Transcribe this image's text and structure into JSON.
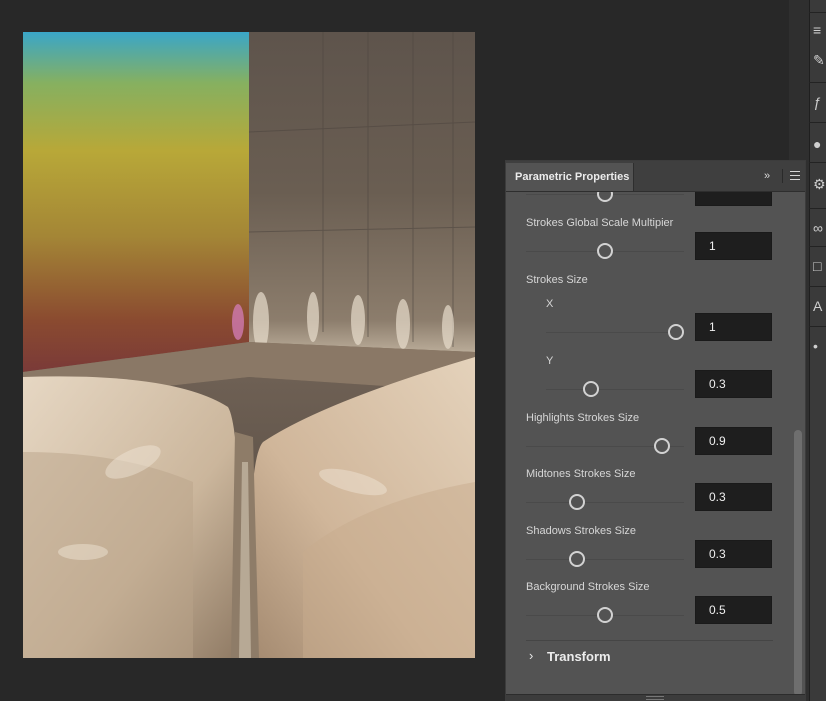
{
  "panel": {
    "title": "Parametric Properties",
    "expand_icon": "double-chevron-right-icon",
    "menu_icon": "hamburger-menu-icon"
  },
  "properties": {
    "top_partial": {
      "value": "",
      "fraction": 0.5
    },
    "global_scale": {
      "label": "Strokes Global Scale Multipier",
      "value": "1",
      "fraction": 0.5
    },
    "strokes_size": {
      "label": "Strokes Size"
    },
    "size_x": {
      "label": "X",
      "value": "1",
      "fraction": 1.0
    },
    "size_y": {
      "label": "Y",
      "value": "0.3",
      "fraction": 0.3
    },
    "highlights": {
      "label": "Highlights Strokes Size",
      "value": "0.9",
      "fraction": 0.9
    },
    "midtones": {
      "label": "Midtones Strokes Size",
      "value": "0.3",
      "fraction": 0.3
    },
    "shadows": {
      "label": "Shadows Strokes Size",
      "value": "0.3",
      "fraction": 0.3
    },
    "background": {
      "label": "Background Strokes Size",
      "value": "0.5",
      "fraction": 0.5
    }
  },
  "transform": {
    "label": "Transform",
    "icon": "chevron-right-icon"
  },
  "tools": [
    "list-icon",
    "brush-icon",
    "script-icon",
    "drop-icon",
    "brush-settings-icon",
    "infinity-icon",
    "square-icon",
    "type-icon",
    "dot-icon"
  ]
}
